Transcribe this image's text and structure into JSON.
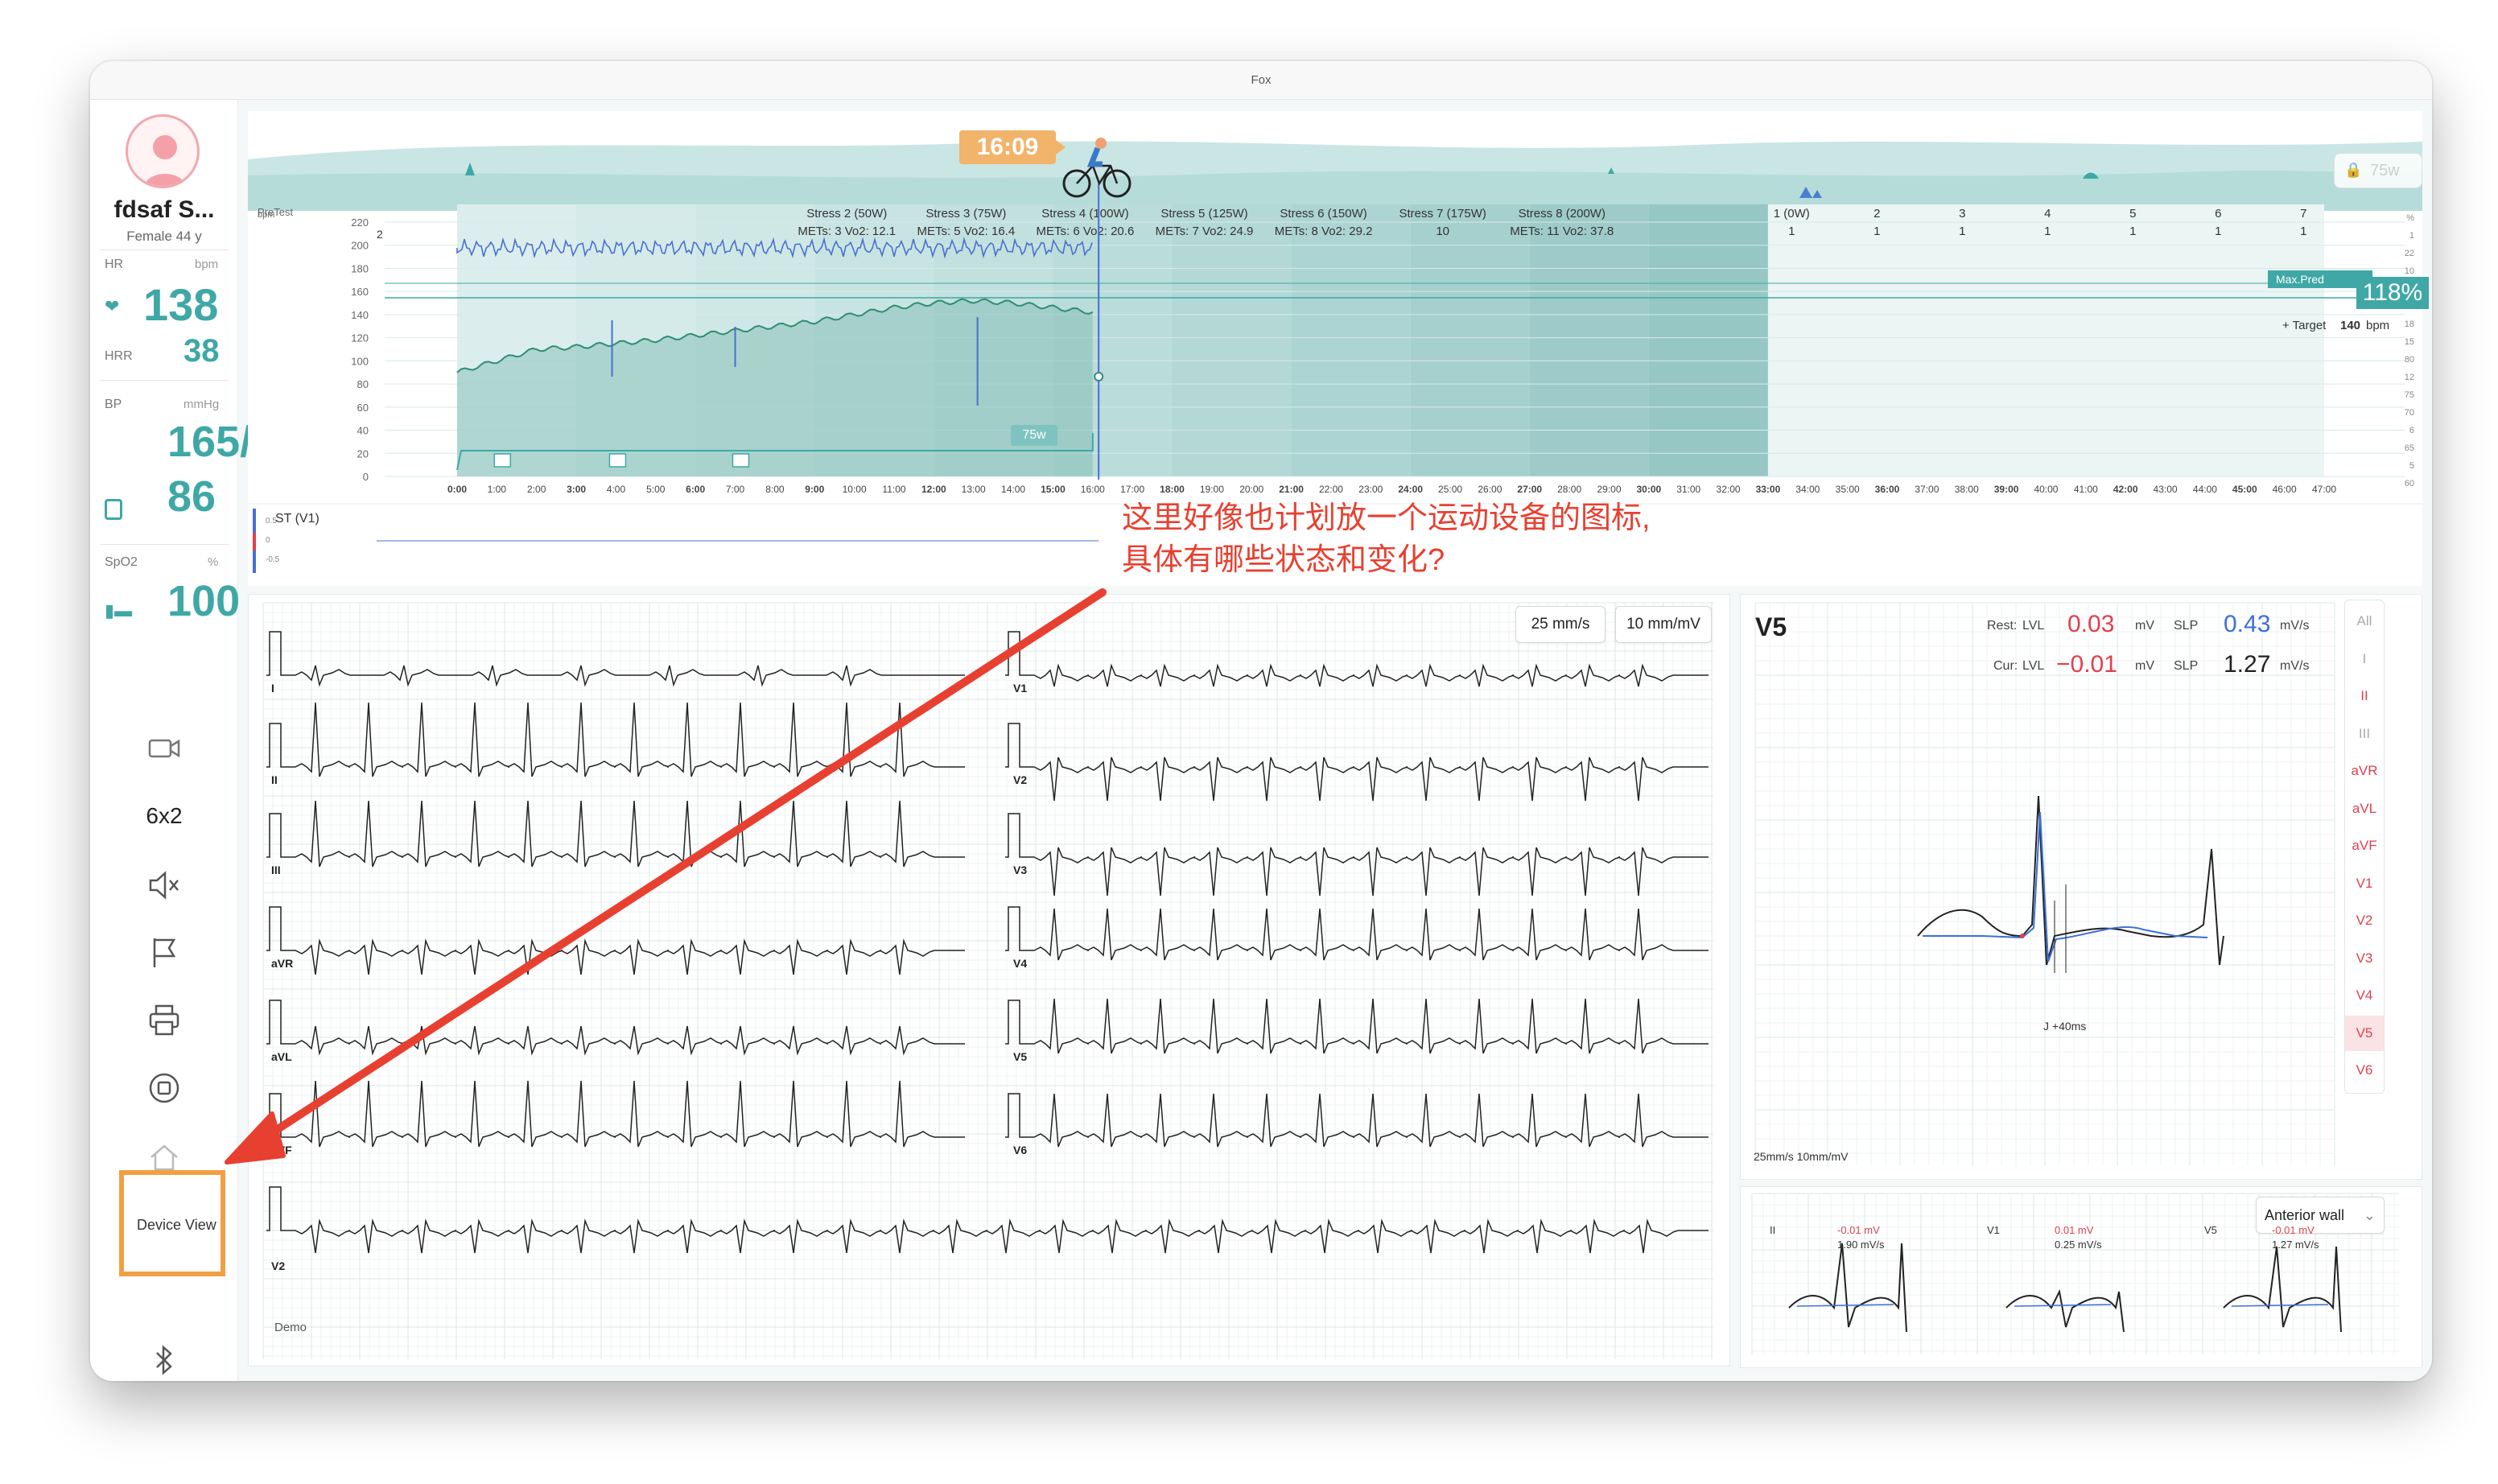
{
  "window": {
    "title": "Fox"
  },
  "patient": {
    "name": "fdsaf S...",
    "info": "Female 44 y"
  },
  "vitals": {
    "hr": {
      "label": "HR",
      "unit": "bpm",
      "value": "138"
    },
    "hrr": {
      "label": "HRR",
      "value": "38"
    },
    "bp": {
      "label": "BP",
      "unit": "mmHg",
      "systolic": "165/",
      "diastolic": "86"
    },
    "spo2": {
      "label": "SpO2",
      "unit": "%",
      "value": "100"
    }
  },
  "sidebar": {
    "layout_label": "6x2",
    "device_view_label": "Device View",
    "icons": [
      "camera-icon",
      "mute-icon",
      "flag-icon",
      "print-icon",
      "stop-icon",
      "home-icon",
      "bluetooth-icon"
    ]
  },
  "trend": {
    "time_badge": "16:09",
    "workload_select": "75w",
    "pretest_label": "PreTest",
    "axis_units": "bpm",
    "stage_labels": [
      {
        "name": "Stress 2 (50W)",
        "mets": "METs: 3  Vo2: 12.1"
      },
      {
        "name": "Stress 3 (75W)",
        "mets": "METs: 5  Vo2: 16.4"
      },
      {
        "name": "Stress 4 (100W)",
        "mets": "METs: 6  Vo2: 20.6"
      },
      {
        "name": "Stress 5 (125W)",
        "mets": "METs: 7  Vo2: 24.9"
      },
      {
        "name": "Stress 6 (150W)",
        "mets": "METs: 8  Vo2: 29.2"
      },
      {
        "name": "Stress 7 (175W)",
        "mets": "10"
      },
      {
        "name": "Stress 8 (200W)",
        "mets": "METs: 11  Vo2: 37.8"
      }
    ],
    "recovery_labels": [
      "1 (0W)",
      "2",
      "3",
      "4",
      "5",
      "6",
      "7"
    ],
    "recovery_values": [
      "1",
      "1",
      "1",
      "1",
      "1",
      "1",
      "1"
    ],
    "y_ticks": [
      "220",
      "200",
      "180",
      "160",
      "140",
      "120",
      "100",
      "80",
      "60",
      "40",
      "20",
      "0"
    ],
    "right_ticks": [
      "%",
      "1",
      "22",
      "10",
      "95",
      "90",
      "18",
      "15",
      "80",
      "12",
      "75",
      "70",
      "6",
      "65",
      "5",
      "60"
    ],
    "x_ticks": [
      "0:00",
      "1:00",
      "2:00",
      "3:00",
      "4:00",
      "5:00",
      "6:00",
      "7:00",
      "8:00",
      "9:00",
      "10:00",
      "11:00",
      "12:00",
      "13:00",
      "14:00",
      "15:00",
      "16:00",
      "17:00",
      "18:00",
      "19:00",
      "20:00",
      "21:00",
      "22:00",
      "23:00",
      "24:00",
      "25:00",
      "26:00",
      "27:00",
      "28:00",
      "29:00",
      "30:00",
      "31:00",
      "32:00",
      "33:00",
      "34:00",
      "35:00",
      "36:00",
      "37:00",
      "38:00",
      "39:00",
      "40:00",
      "41:00",
      "42:00",
      "43:00",
      "44:00",
      "45:00",
      "46:00",
      "47:00"
    ],
    "workload_marker": "75w",
    "maxpred_label": "Max.Pred",
    "maxpred_percent": "118%",
    "target_label": "+ Target",
    "target_value": "140",
    "target_unit": "bpm",
    "st_label": "ST (V1)",
    "st_ticks": [
      "0.5",
      "0",
      "-0.5"
    ]
  },
  "annotation": {
    "line1": "这里好像也计划放一个运动设备的图标,",
    "line2": "具体有哪些状态和变化?",
    "color": "#e84030"
  },
  "ecg": {
    "speed_button": "25 mm/s",
    "gain_button": "10 mm/mV",
    "demo_label": "Demo",
    "left_leads": [
      "I",
      "II",
      "III",
      "aVR",
      "aVL",
      "aVF"
    ],
    "right_leads": [
      "V1",
      "V2",
      "V3",
      "V4",
      "V5",
      "V6"
    ],
    "rhythm_lead": "V2"
  },
  "detail": {
    "lead": "V5",
    "rest_label": "Rest:",
    "cur_label": "Cur:",
    "lvl_label": "LVL",
    "slp_label": "SLP",
    "rest_lvl": "0.03",
    "rest_slp": "0.43",
    "cur_lvl": "−0.01",
    "cur_slp": "1.27",
    "unit_mv": "mV",
    "unit_mvs": "mV/s",
    "j_label": "J  +40ms",
    "footer": "25mm/s  10mm/mV",
    "lead_buttons": [
      "All",
      "I",
      "II",
      "III",
      "aVR",
      "aVL",
      "aVF",
      "V1",
      "V2",
      "V3",
      "V4",
      "V5",
      "V6"
    ],
    "selected_lead": "V5"
  },
  "wall": {
    "dropdown": "Anterior wall",
    "leads": [
      {
        "name": "II",
        "lvl": "-0.01 mV",
        "slp": "1.90 mV/s"
      },
      {
        "name": "V1",
        "lvl": "0.01 mV",
        "slp": "0.25 mV/s"
      },
      {
        "name": "V5",
        "lvl": "-0.01 mV",
        "slp": "1.27 mV/s"
      }
    ]
  },
  "colors": {
    "accent": "#3fa8a6",
    "hr_line": "#2f8d70",
    "red": "#e0404c",
    "blue": "#3d6fd6",
    "grid": "#e3ecec"
  }
}
